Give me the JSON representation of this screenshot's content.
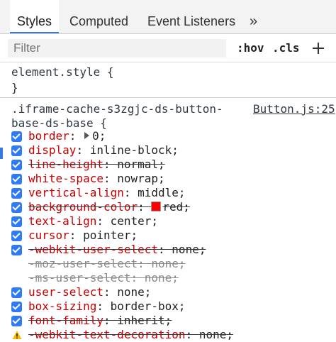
{
  "tabs": [
    {
      "label": "Styles"
    },
    {
      "label": "Computed"
    },
    {
      "label": "Event Listeners"
    },
    {
      "label": "»"
    }
  ],
  "filter": {
    "placeholder": "Filter",
    "hov_label": ":hov",
    "cls_label": ".cls"
  },
  "element_style": {
    "selector": "element.style {",
    "close": "}"
  },
  "rule": {
    "selector_line1": ".iframe-cache-s3zgjc-ds-button-",
    "selector_line2": "base-ds-base {",
    "source": "Button.js:25",
    "properties": [
      {
        "name": "border",
        "value": "0",
        "has_triangle": true,
        "checked": true,
        "overridden": false
      },
      {
        "name": "display",
        "value": "inline-block",
        "checked": true,
        "overridden": false
      },
      {
        "name": "line-height",
        "value": "normal",
        "checked": true,
        "overridden": true
      },
      {
        "name": "white-space",
        "value": "nowrap",
        "checked": true,
        "overridden": false
      },
      {
        "name": "vertical-align",
        "value": "middle",
        "checked": true,
        "overridden": false
      },
      {
        "name": "background-color",
        "value": "red",
        "swatch": "#ff0000",
        "checked": true,
        "overridden": true
      },
      {
        "name": "text-align",
        "value": "center",
        "checked": true,
        "overridden": false
      },
      {
        "name": "cursor",
        "value": "pointer",
        "checked": true,
        "overridden": false
      },
      {
        "name": "-webkit-user-select",
        "value": "none",
        "checked": true,
        "overridden": true
      },
      {
        "name": "-moz-user-select",
        "value": "none",
        "checked": false,
        "overridden": true,
        "invalid": true
      },
      {
        "name": "-ms-user-select",
        "value": "none",
        "checked": false,
        "overridden": true,
        "invalid": true
      },
      {
        "name": "user-select",
        "value": "none",
        "checked": true,
        "overridden": false
      },
      {
        "name": "box-sizing",
        "value": "border-box",
        "checked": true,
        "overridden": false
      },
      {
        "name": "font-family",
        "value": "inherit",
        "checked": true,
        "overridden": true
      },
      {
        "name": "-webkit-text-decoration",
        "value": "none",
        "checked": false,
        "overridden": true,
        "warning": true
      }
    ]
  },
  "colors": {
    "accent": "#3879d9",
    "checkbox": "#2f7bf5",
    "prop_name": "#c80000",
    "swatch_red": "#ff0000"
  }
}
